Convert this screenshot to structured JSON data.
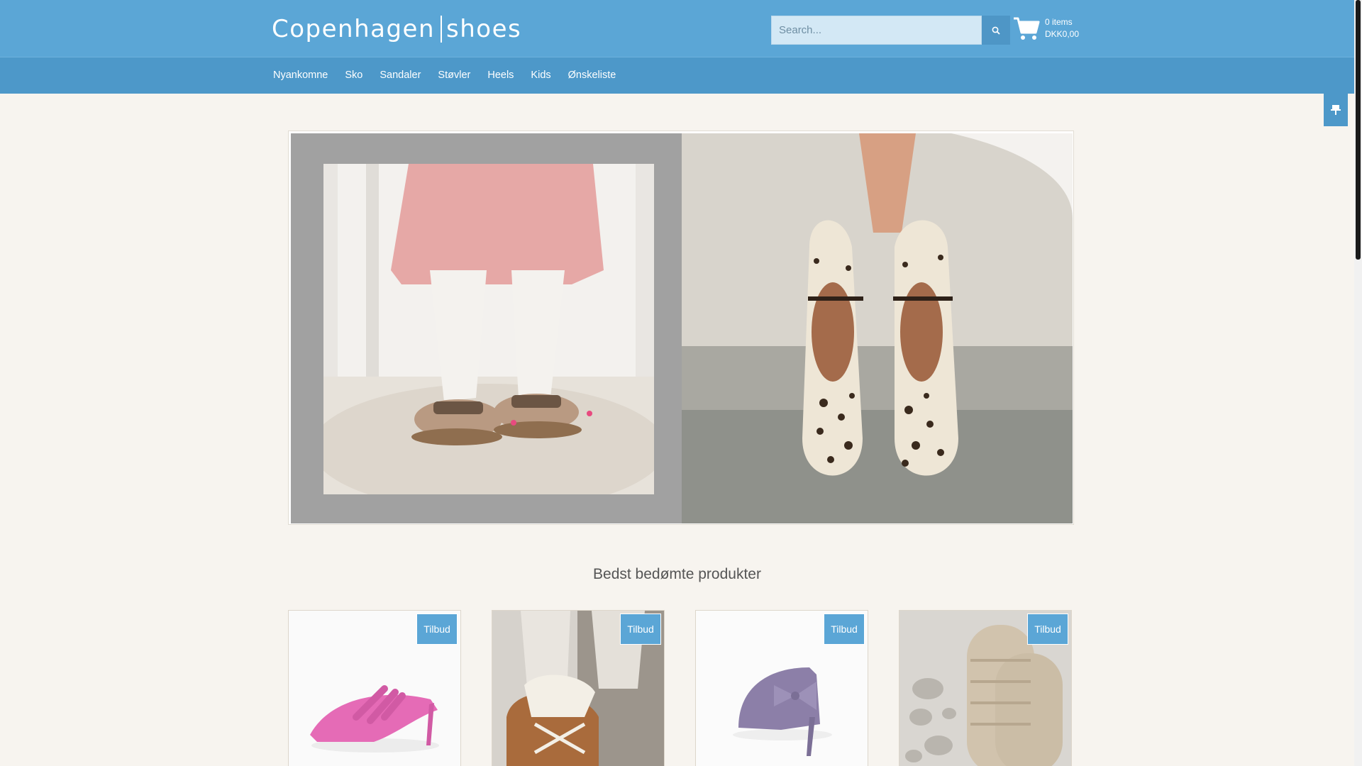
{
  "brand": {
    "logo_left": "Copenhagen",
    "logo_right": "shoes"
  },
  "search": {
    "placeholder": "Search..."
  },
  "cart": {
    "items": "0 items",
    "total": "DKK0,00"
  },
  "nav": {
    "items": [
      {
        "label": "Nyankomne"
      },
      {
        "label": "Sko"
      },
      {
        "label": "Sandaler"
      },
      {
        "label": "Støvler"
      },
      {
        "label": "Heels"
      },
      {
        "label": "Kids"
      },
      {
        "label": "Ønskeliste"
      }
    ]
  },
  "section": {
    "title": "Bedst bedømte produkter"
  },
  "products": [
    {
      "badge": "Tilbud"
    },
    {
      "badge": "Tilbud"
    },
    {
      "badge": "Tilbud"
    },
    {
      "badge": "Tilbud"
    }
  ],
  "colors": {
    "header": "#5ba6d6",
    "nav": "#4d98c9",
    "background": "#f7f4ef"
  },
  "icons": {
    "search": "search-icon",
    "cart": "cart-icon",
    "side_tab": "pin-icon"
  }
}
